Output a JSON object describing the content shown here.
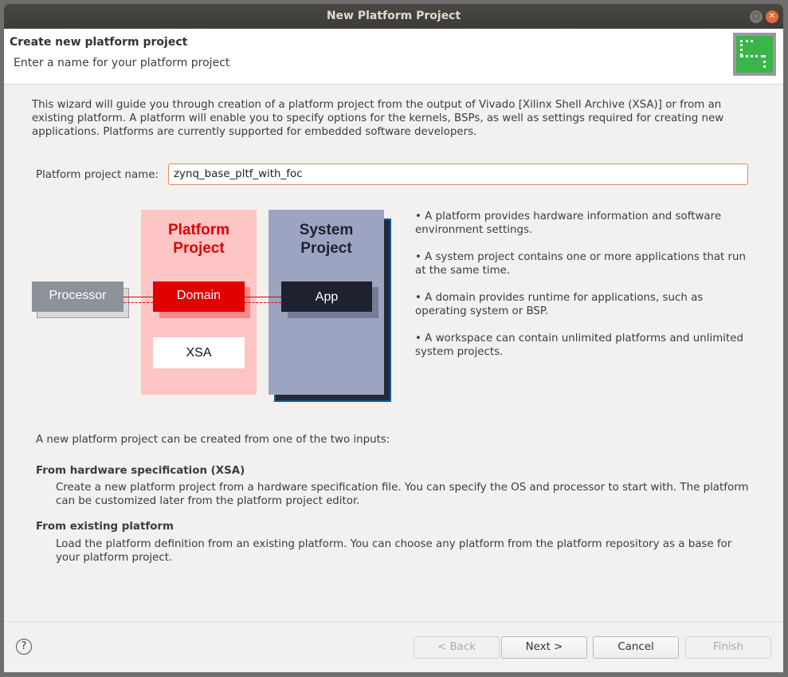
{
  "window": {
    "title": "New Platform Project"
  },
  "header": {
    "title": "Create new platform project",
    "subtitle": "Enter a name for your platform project"
  },
  "intro": "This wizard will guide you through creation of a platform project from the output of Vivado [Xilinx Shell Archive (XSA)] or from an existing platform. A platform will enable you to specify options for the kernels, BSPs, as well as settings required for creating new applications. Platforms are currently supported for embedded software developers.",
  "form": {
    "name_label": "Platform project name:",
    "name_value": "zynq_base_pltf_with_foc"
  },
  "diagram": {
    "processor": "Processor",
    "platform_title_1": "Platform",
    "platform_title_2": "Project",
    "domain": "Domain",
    "xsa": "XSA",
    "system_title_1": "System",
    "system_title_2": "Project",
    "app": "App"
  },
  "bullets": [
    "• A platform provides hardware information and software environment settings.",
    "• A system project contains one or more applications that run at the same time.",
    "• A domain provides runtime for applications, such as operating system or BSP.",
    "• A workspace can contain unlimited platforms and unlimited system projects."
  ],
  "inputs": {
    "lead": "A new platform project can be created from one of the two inputs:",
    "opt1_title": "From hardware specification (XSA)",
    "opt1_desc": "Create a new platform project from a hardware specification file. You can specify the OS and processor to start with. The platform can be customized later from the platform project editor.",
    "opt2_title": "From existing platform",
    "opt2_desc": "Load the platform definition from an existing platform. You can choose any platform from the platform repository as a base for your platform project."
  },
  "footer": {
    "back": "< Back",
    "next": "Next >",
    "cancel": "Cancel",
    "finish": "Finish",
    "help": "?"
  }
}
